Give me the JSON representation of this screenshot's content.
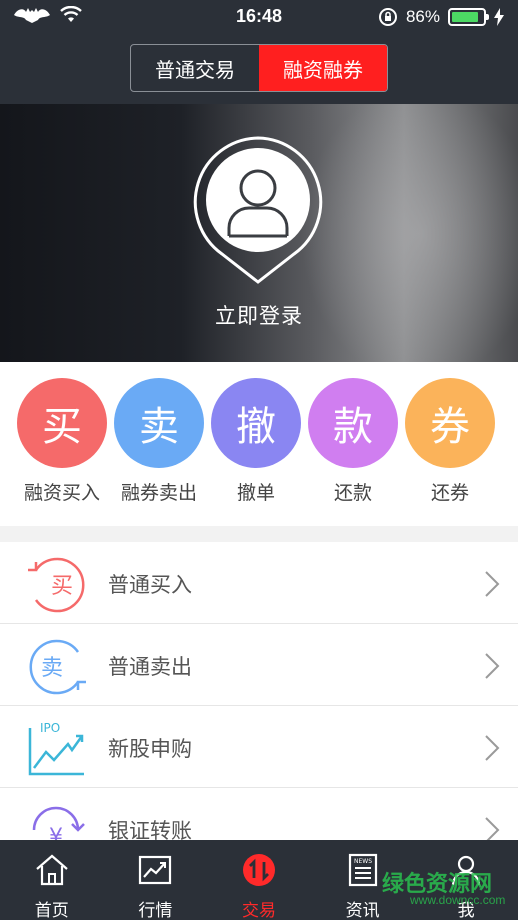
{
  "status": {
    "time": "16:48",
    "battery_text": "86%",
    "battery_level": 0.86
  },
  "segmented": {
    "options": [
      "普通交易",
      "融资融券"
    ],
    "selected": "融资融券"
  },
  "banner": {
    "login_label": "立即登录"
  },
  "quick_actions": [
    {
      "glyph": "买",
      "label": "融资买入",
      "color": "#f56a6a"
    },
    {
      "glyph": "卖",
      "label": "融券卖出",
      "color": "#6aaaf5"
    },
    {
      "glyph": "撤",
      "label": "撤单",
      "color": "#8a86f2"
    },
    {
      "glyph": "款",
      "label": "还款",
      "color": "#d07ef0"
    },
    {
      "glyph": "券",
      "label": "还券",
      "color": "#fbb35a"
    }
  ],
  "list": [
    {
      "label": "普通买入",
      "icon": "buy-cycle-icon"
    },
    {
      "label": "普通卖出",
      "icon": "sell-cycle-icon"
    },
    {
      "label": "新股申购",
      "icon": "ipo-chart-icon",
      "icon_text": "IPO"
    },
    {
      "label": "银证转账",
      "icon": "transfer-yen-icon",
      "icon_text": "¥"
    }
  ],
  "icons": {
    "buy_glyph": "买",
    "sell_glyph": "卖"
  },
  "tabs": [
    {
      "label": "首页",
      "icon": "home-icon"
    },
    {
      "label": "行情",
      "icon": "chart-icon"
    },
    {
      "label": "交易",
      "icon": "trade-icon"
    },
    {
      "label": "资讯",
      "icon": "news-icon",
      "icon_text": "NEWS"
    },
    {
      "label": "我",
      "icon": "profile-icon"
    }
  ],
  "active_tab": "交易",
  "watermark": {
    "main": "绿色资源网",
    "sub": "www.downcc.com"
  }
}
